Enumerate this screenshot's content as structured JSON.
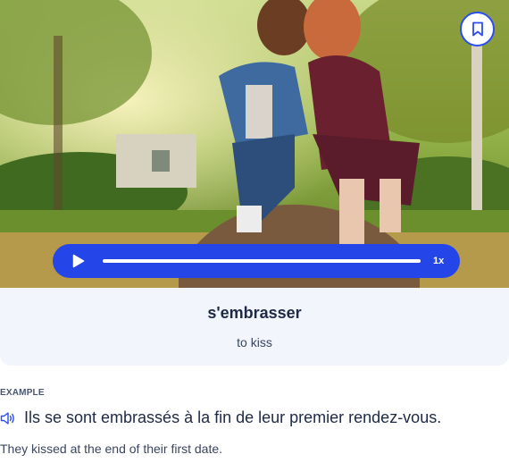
{
  "hero": {
    "image": "couple-kissing-photo",
    "bookmark_icon": "bookmark-icon"
  },
  "player": {
    "play_icon": "play-icon",
    "progress": 0,
    "speed_label": "1x",
    "accent_color": "#2446e8"
  },
  "card": {
    "word": "s'embrasser",
    "translation": "to kiss"
  },
  "example": {
    "label": "EXAMPLE",
    "speaker_icon": "speaker-icon",
    "sentence": "Ils se sont embrassés à la fin de leur premier rendez-vous.",
    "translation": "They kissed at the end of their first date."
  }
}
